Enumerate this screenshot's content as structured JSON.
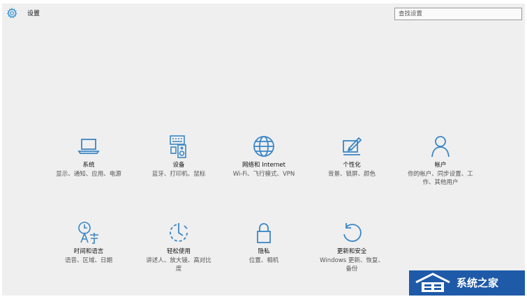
{
  "header": {
    "title": "设置",
    "app_icon": "gear-icon"
  },
  "search": {
    "placeholder": "查找设置"
  },
  "tiles": [
    {
      "icon": "laptop-icon",
      "title": "系统",
      "desc": "显示、通知、应用、电源"
    },
    {
      "icon": "devices-icon",
      "title": "设备",
      "desc": "蓝牙、打印机、鼠标"
    },
    {
      "icon": "globe-icon",
      "title": "网络和 Internet",
      "desc": "Wi-Fi、飞行模式、VPN"
    },
    {
      "icon": "personalization-icon",
      "title": "个性化",
      "desc": "背景、锁屏、颜色"
    },
    {
      "icon": "person-icon",
      "title": "帐户",
      "desc": "你的帐户、同步设置、工作、其他用户"
    },
    {
      "icon": "time-language-icon",
      "title": "时间和语言",
      "desc": "语音、区域、日期"
    },
    {
      "icon": "ease-of-access-icon",
      "title": "轻松使用",
      "desc": "讲述人、放大镜、高对比度"
    },
    {
      "icon": "lock-icon",
      "title": "隐私",
      "desc": "位置、相机"
    },
    {
      "icon": "update-security-icon",
      "title": "更新和安全",
      "desc": "Windows 更新、恢复、备份"
    }
  ],
  "watermark": {
    "text": "系统之家"
  },
  "colors": {
    "accent": "#3a86c6",
    "background": "#efefef",
    "watermark_bg": "#1e5aa8"
  }
}
